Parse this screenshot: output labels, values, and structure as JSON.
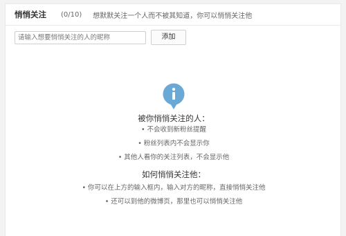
{
  "header": {
    "title": "悄悄关注",
    "count": "(0/10)",
    "hint": "想默默关注一个人而不被其知道，你可以悄悄关注他"
  },
  "form": {
    "placeholder": "请输入想要悄悄关注的人的昵称",
    "add_label": "添加"
  },
  "icons": {
    "info": "info-icon",
    "info_color": "#6aa9d6"
  },
  "section1": {
    "heading": "被你悄悄关注的人：",
    "items": [
      "• 不会收到新粉丝提醒",
      "• 粉丝列表内不会显示你",
      "• 其他人看你的关注列表，不会显示他"
    ]
  },
  "section2": {
    "heading": "如何悄悄关注他：",
    "items": [
      "• 你可以在上方的输入框内，输入对方的昵称，直接悄悄关注他",
      "• 还可以到他的微博页，那里也可以悄悄关注他"
    ]
  }
}
